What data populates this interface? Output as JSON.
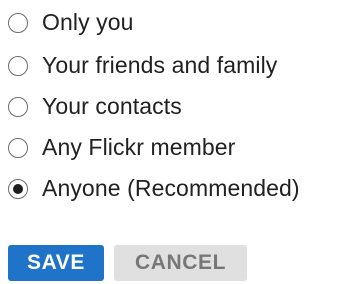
{
  "privacy_options": [
    {
      "label": "Only you",
      "selected": false
    },
    {
      "label": "Your friends and family",
      "selected": false
    },
    {
      "label": "Your contacts",
      "selected": false
    },
    {
      "label": "Any Flickr member",
      "selected": false
    },
    {
      "label": "Anyone (Recommended)",
      "selected": true
    }
  ],
  "buttons": {
    "save_label": "SAVE",
    "cancel_label": "CANCEL"
  },
  "colors": {
    "save_bg": "#1f73c8",
    "cancel_bg": "#e0e0e0",
    "cancel_text": "#777777"
  }
}
